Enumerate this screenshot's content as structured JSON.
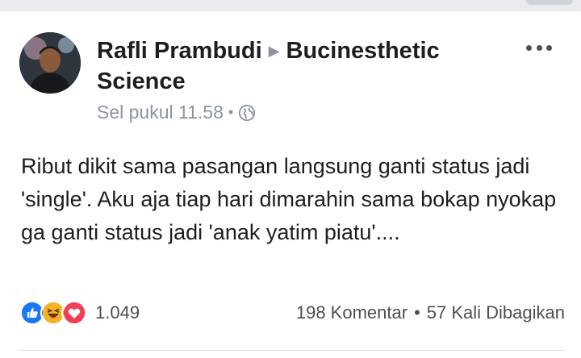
{
  "post": {
    "author": "Rafli Prambudi",
    "group": "Bucinesthetic Science",
    "timestamp": "Sel pukul 11.58",
    "privacy_icon": "globe-icon",
    "message": "Ribut dikit sama pasangan langsung ganti status jadi 'single'. Aku aja tiap hari dimarahin sama bokap nyokap ga ganti status jadi 'anak yatim piatu'....",
    "reactions": [
      "like",
      "haha",
      "love"
    ],
    "reaction_count": "1.049",
    "comments": "198 Komentar",
    "shares": "57 Kali Dibagikan"
  },
  "colors": {
    "like": "#1877f2",
    "haha": "#f7b125",
    "love": "#f33e58",
    "text_muted": "#8d949e"
  }
}
